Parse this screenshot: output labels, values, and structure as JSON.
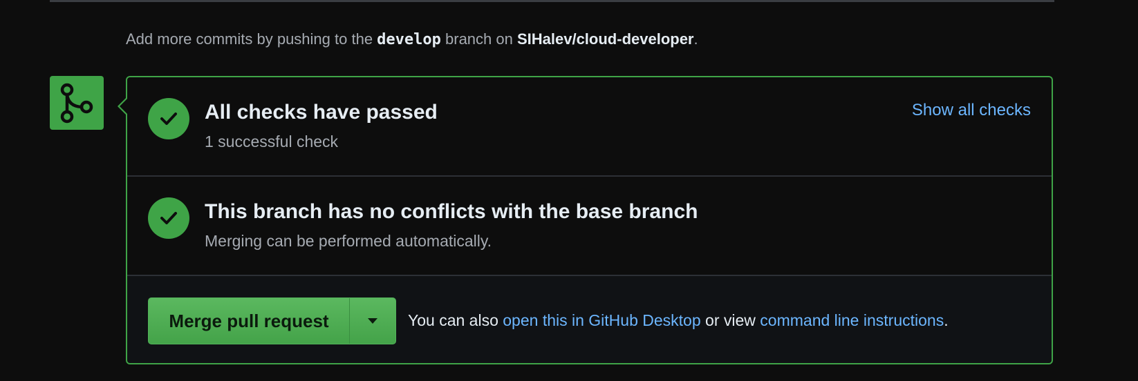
{
  "push_hint": {
    "prefix": "Add more commits by pushing to the ",
    "branch": "develop",
    "middle": " branch on ",
    "repo": "SIHalev/cloud-developer",
    "suffix": "."
  },
  "badge": {
    "icon": "git-merge-icon",
    "color": "#3fa447"
  },
  "checks": {
    "title": "All checks have passed",
    "subtitle": "1 successful check",
    "link_label": "Show all checks",
    "icon": "check-icon"
  },
  "conflicts": {
    "title": "This branch has no conflicts with the base branch",
    "subtitle": "Merging can be performed automatically.",
    "icon": "check-icon"
  },
  "merge": {
    "button_label": "Merge pull request",
    "dropdown_icon": "caret-down-icon",
    "hint_prefix": "You can also ",
    "desktop_link": "open this in GitHub Desktop",
    "hint_middle": " or view ",
    "cli_link": "command line instructions",
    "hint_suffix": "."
  },
  "colors": {
    "success": "#3fa447",
    "link": "#6cb6ff",
    "background": "#0d0d0d"
  }
}
